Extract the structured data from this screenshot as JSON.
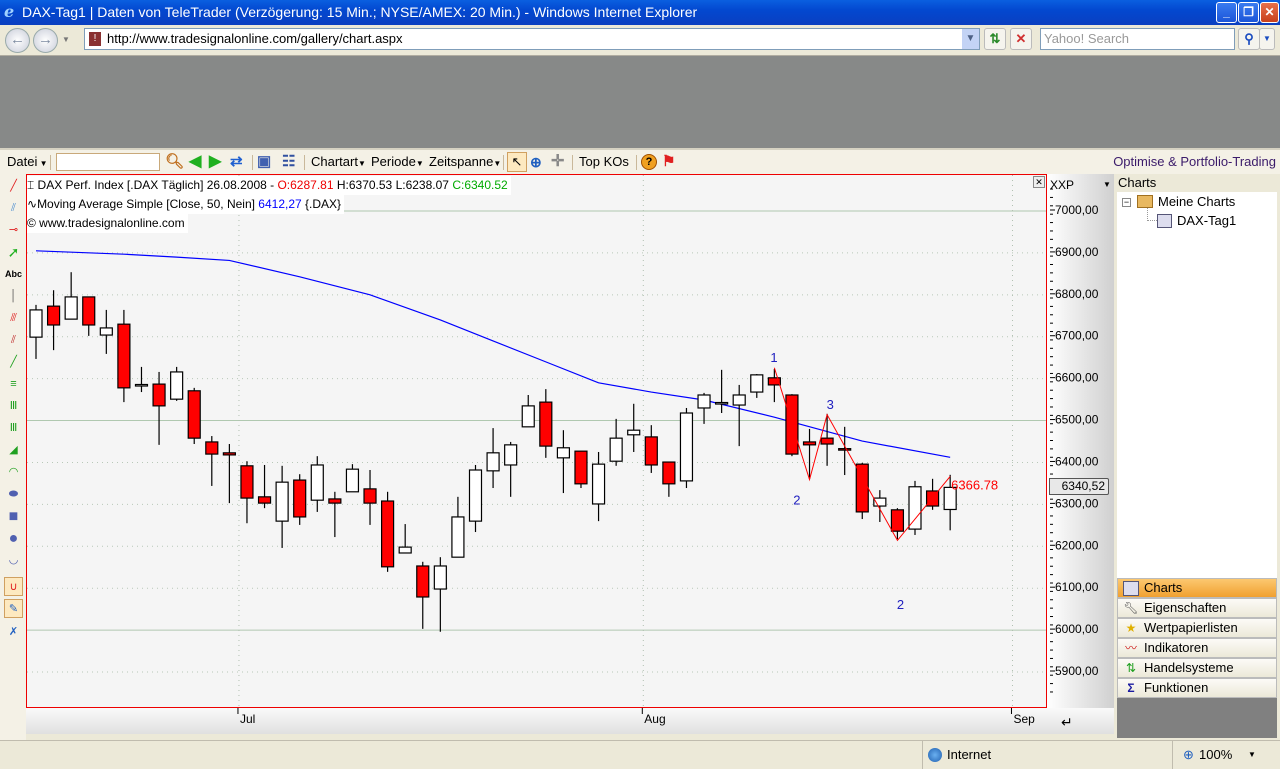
{
  "window": {
    "title": "DAX-Tag1 | Daten von TeleTrader (Verzögerung: 15 Min.; NYSE/AMEX: 20 Min.) - Windows Internet Explorer",
    "minimize": "_",
    "restore": "❐",
    "close": "✕"
  },
  "browser": {
    "url": "http://www.tradesignalonline.com/gallery/chart.aspx",
    "search_placeholder": "Yahoo! Search",
    "zone": "Internet",
    "zoom": "100%"
  },
  "toolbar": {
    "datei": "Datei",
    "chartart": "Chartart",
    "periode": "Periode",
    "zeitspanne": "Zeitspanne",
    "top_kos": "Top KOs",
    "promo": "Optimise & Portfolio-Trading",
    "symbol_input": ""
  },
  "legend": {
    "line1_prefix": "DAX Perf. Index [.DAX  Täglich] 26.08.2008 - ",
    "open": "O:6287.81",
    "high": "H:6370.53",
    "low": "L:6238.07",
    "close": "C:6340.52",
    "line2_prefix": "Moving Average Simple [Close, 50, Nein] ",
    "ma_value": "6412,27",
    "line2_suffix": " {.DAX}",
    "line3": "© www.tradesignalonline.com"
  },
  "axis": {
    "scale_name": "XXP",
    "last_price": "6340,52"
  },
  "right_panel": {
    "header": "Charts",
    "tree": [
      {
        "label": "Meine Charts"
      },
      {
        "label": "DAX-Tag1"
      }
    ],
    "nav": [
      {
        "label": "Charts",
        "icon": "chart-grid-icon",
        "active": true
      },
      {
        "label": "Eigenschaften",
        "icon": "wrench-icon"
      },
      {
        "label": "Wertpapierlisten",
        "icon": "list-star-icon"
      },
      {
        "label": "Indikatoren",
        "icon": "indicator-icon"
      },
      {
        "label": "Handelsysteme",
        "icon": "arrows-updown-icon"
      },
      {
        "label": "Funktionen",
        "icon": "sigma-icon"
      }
    ]
  },
  "colors": {
    "up": "#ffffff",
    "down": "#ff0000",
    "ma": "#0000ff",
    "wave": "#ff0000",
    "wave_label": "#2020c0"
  },
  "chart_data": {
    "type": "candlestick",
    "title": "DAX Perf. Index [.DAX Täglich]",
    "ylim": [
      5850,
      7050
    ],
    "yticks": [
      7000,
      6900,
      6800,
      6700,
      6600,
      6500,
      6400,
      6300,
      6200,
      6100,
      6000,
      5900
    ],
    "ytick_labels": [
      "7000,00",
      "6900,00",
      "6800,00",
      "6700,00",
      "6600,00",
      "6500,00",
      "6400,00",
      "6300,00",
      "6200,00",
      "6100,00",
      "6000,00",
      "5900,00"
    ],
    "xticks": [
      {
        "label": "Jul",
        "index": 12
      },
      {
        "label": "Aug",
        "index": 35
      },
      {
        "label": "Sep",
        "index": 56
      }
    ],
    "ohlc": [
      [
        6699,
        6776,
        6647,
        6764
      ],
      [
        6773,
        6811,
        6668,
        6728
      ],
      [
        6742,
        6854,
        6742,
        6795
      ],
      [
        6795,
        6795,
        6702,
        6728
      ],
      [
        6704,
        6764,
        6659,
        6721
      ],
      [
        6730,
        6764,
        6544,
        6578
      ],
      [
        6585,
        6628,
        6568,
        6586
      ],
      [
        6587,
        6616,
        6442,
        6535
      ],
      [
        6551,
        6628,
        6547,
        6616
      ],
      [
        6571,
        6578,
        6444,
        6458
      ],
      [
        6449,
        6463,
        6344,
        6420
      ],
      [
        6423,
        6444,
        6303,
        6418
      ],
      [
        6392,
        6403,
        6255,
        6315
      ],
      [
        6318,
        6394,
        6291,
        6303
      ],
      [
        6260,
        6392,
        6196,
        6353
      ],
      [
        6358,
        6372,
        6251,
        6270
      ],
      [
        6310,
        6415,
        6282,
        6394
      ],
      [
        6313,
        6330,
        6222,
        6303
      ],
      [
        6330,
        6396,
        6330,
        6384
      ],
      [
        6337,
        6382,
        6251,
        6303
      ],
      [
        6308,
        6330,
        6139,
        6151
      ],
      [
        6184,
        6253,
        6184,
        6198
      ],
      [
        6153,
        6163,
        6003,
        6079
      ],
      [
        6098,
        6174,
        5996,
        6153
      ],
      [
        6174,
        6318,
        6174,
        6270
      ],
      [
        6260,
        6394,
        6234,
        6382
      ],
      [
        6380,
        6482,
        6339,
        6423
      ],
      [
        6394,
        6449,
        6318,
        6442
      ],
      [
        6485,
        6561,
        6485,
        6535
      ],
      [
        6544,
        6575,
        6411,
        6439
      ],
      [
        6411,
        6477,
        6327,
        6435
      ],
      [
        6427,
        6427,
        6339,
        6349
      ],
      [
        6301,
        6425,
        6260,
        6396
      ],
      [
        6403,
        6504,
        6392,
        6458
      ],
      [
        6466,
        6540,
        6425,
        6477
      ],
      [
        6461,
        6489,
        6375,
        6394
      ],
      [
        6401,
        6401,
        6318,
        6349
      ],
      [
        6356,
        6530,
        6339,
        6518
      ],
      [
        6530,
        6566,
        6492,
        6561
      ],
      [
        6542,
        6621,
        6518,
        6543
      ],
      [
        6537,
        6585,
        6439,
        6561
      ],
      [
        6568,
        6611,
        6554,
        6609
      ],
      [
        6602,
        6623,
        6544,
        6585
      ],
      [
        6561,
        6563,
        6415,
        6420
      ],
      [
        6449,
        6480,
        6361,
        6442
      ],
      [
        6458,
        6516,
        6392,
        6444
      ],
      [
        6433,
        6485,
        6370,
        6432
      ],
      [
        6396,
        6399,
        6265,
        6282
      ],
      [
        6296,
        6334,
        6258,
        6315
      ],
      [
        6287,
        6291,
        6217,
        6236
      ],
      [
        6241,
        6356,
        6227,
        6342
      ],
      [
        6332,
        6361,
        6287,
        6296
      ],
      [
        6287.81,
        6370.53,
        6238.07,
        6340.52
      ]
    ],
    "ma50": [
      [
        0,
        6905
      ],
      [
        5,
        6897
      ],
      [
        8,
        6890
      ],
      [
        11,
        6882
      ],
      [
        15,
        6843
      ],
      [
        19,
        6800
      ],
      [
        23,
        6740
      ],
      [
        26,
        6690
      ],
      [
        29,
        6640
      ],
      [
        32,
        6590
      ],
      [
        35,
        6568
      ],
      [
        38,
        6549
      ],
      [
        42,
        6508
      ],
      [
        47,
        6451
      ],
      [
        52,
        6412.27
      ]
    ],
    "wave": {
      "points": [
        [
          42,
          6626
        ],
        [
          44,
          6359
        ],
        [
          45,
          6514
        ],
        [
          49,
          6214
        ],
        [
          52,
          6366.78
        ]
      ],
      "labels": [
        {
          "text": "1",
          "index": 42,
          "value": 6640
        },
        {
          "text": "2",
          "index": 43.3,
          "value": 6300
        },
        {
          "text": "3",
          "index": 45.2,
          "value": 6528
        },
        {
          "text": "2",
          "index": 49.2,
          "value": 6050
        }
      ],
      "end_label": "6366.78"
    }
  }
}
